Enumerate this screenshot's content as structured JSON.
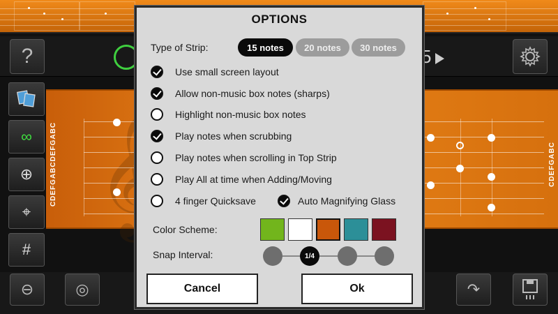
{
  "toolbar": {
    "help_glyph": "?",
    "tempo_tail": "5"
  },
  "strip": {
    "left_note_labels": "CDEFGABCDEFGABC",
    "right_note_labels": "CDEFGABC"
  },
  "dialog": {
    "title": "OPTIONS",
    "strip_type_label": "Type of Strip:",
    "strip_types": [
      {
        "label": "15 notes",
        "selected": true
      },
      {
        "label": "20 notes",
        "selected": false
      },
      {
        "label": "30 notes",
        "selected": false
      }
    ],
    "options": [
      {
        "label": "Use small screen layout",
        "checked": true
      },
      {
        "label": "Allow non-music box notes (sharps)",
        "checked": true
      },
      {
        "label": "Highlight non-music box notes",
        "checked": false
      },
      {
        "label": "Play notes when scrubbing",
        "checked": true
      },
      {
        "label": "Play notes when scrolling in Top Strip",
        "checked": false
      },
      {
        "label": "Play All at time when Adding/Moving",
        "checked": false
      }
    ],
    "quicksave_label": "4 finger Quicksave",
    "quicksave_checked": false,
    "magnify_label": "Auto Magnifying Glass",
    "magnify_checked": true,
    "color_scheme_label": "Color Scheme:",
    "color_schemes": [
      {
        "color": "#72b51c",
        "selected": false
      },
      {
        "color": "#ffffff",
        "selected": false
      },
      {
        "color": "#c9570a",
        "selected": true
      },
      {
        "color": "#2c8f98",
        "selected": false
      },
      {
        "color": "#7b1220",
        "selected": false
      }
    ],
    "snap_label": "Snap Interval:",
    "snap_selected_label": "1/4",
    "cancel_label": "Cancel",
    "ok_label": "Ok"
  },
  "colors": {
    "accent_green": "#3fcf3f",
    "strip_orange": "#e98418"
  }
}
